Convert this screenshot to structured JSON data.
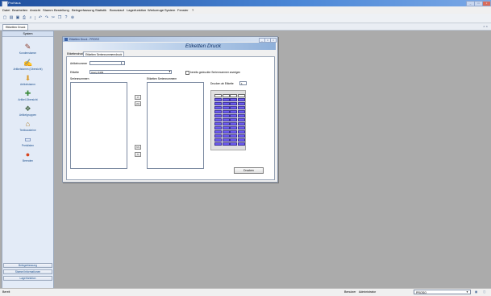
{
  "app": {
    "title": "ProHaus",
    "window_buttons": [
      "_",
      "□",
      "×"
    ]
  },
  "menu": [
    "Datei",
    "Bearbeiten",
    "Ansicht",
    "Stamm",
    "Bestellung",
    "Belegerfassung",
    "Statistik",
    "Bonuslauf",
    "Lagerfunktion",
    "Werkzeuge",
    "System",
    "Fenster",
    "?"
  ],
  "toolbar": {
    "icons": [
      "new-icon",
      "open-icon",
      "save-icon",
      "print-icon",
      "search-icon",
      "undo-icon",
      "redo-icon",
      "cut-icon",
      "copy-icon",
      "help-icon",
      "zoom-icon"
    ]
  },
  "doc_tab": "Etiketten Druck",
  "sidebar": {
    "header": "System",
    "items": [
      {
        "label": "Kundenstamm",
        "icon": "notepad-icon"
      },
      {
        "label": "Artikelstamm (Übersicht)",
        "icon": "notepad-pen-icon"
      },
      {
        "label": "Artikelstamm",
        "icon": "download-icon"
      },
      {
        "label": "Artikel-Übersicht",
        "icon": "grid-icon"
      },
      {
        "label": "Artikelgruppen",
        "icon": "group-icon"
      },
      {
        "label": "Textbausteine",
        "icon": "house-icon"
      },
      {
        "label": "Preislisten",
        "icon": "monitor-icon"
      },
      {
        "label": "Beenden",
        "icon": "power-icon"
      }
    ],
    "buttons": [
      "Belegerfassung",
      "Stamm/Informationen",
      "Lagerfunktion"
    ]
  },
  "child_window": {
    "title": "Etiketten Druck - PROSO",
    "banner": "Etiketten Druck",
    "tabs": [
      "Etikettendruck",
      "Etiketten Seriennummerndruck"
    ],
    "active_tab": 1,
    "form": {
      "artikelnummer_label": "Artikelnummer",
      "artikelnummer_value": "",
      "etikette_label": "Etikette",
      "etikette_value": "Avery 6409",
      "checkbox_label": "bereits gedruckte Seriennummer anzeigen",
      "checkbox_checked": false,
      "seriennummern_label": "Seriennummern",
      "etiketten_label": "Etiketten Seriennummern",
      "drucken_ab_label": "Drucken ab Etikette",
      "drucken_ab_value": "1"
    },
    "arrows": [
      ">",
      ">>",
      "<<",
      "<"
    ],
    "drucken_button": "Drucken"
  },
  "label_grid": {
    "columns": 4,
    "rows": 13,
    "start_label": 1,
    "header_marks": [
      "1",
      "2",
      "3",
      "4"
    ]
  },
  "statusbar": {
    "left": "Bereit",
    "user_label": "Benutzer",
    "user_value": "Administrator",
    "company_value": "PROSO",
    "right_icons": [
      "calc-icon",
      "info-icon"
    ]
  }
}
